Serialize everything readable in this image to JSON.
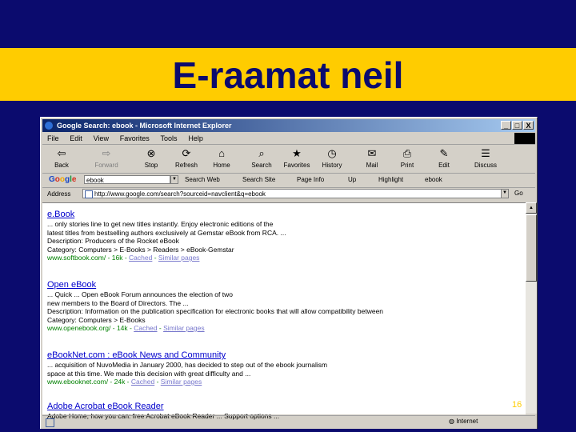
{
  "slide": {
    "title": "E-raamat neil",
    "page_number": "16"
  },
  "window": {
    "title": "Google Search: ebook - Microsoft Internet Explorer",
    "buttons": [
      "_",
      "□",
      "X"
    ]
  },
  "menu": [
    "File",
    "Edit",
    "View",
    "Favorites",
    "Tools",
    "Help"
  ],
  "toolbar": [
    {
      "label": "Back",
      "icon": "back-arrow-icon",
      "glyph": "⇦"
    },
    {
      "label": "Forward",
      "icon": "forward-arrow-icon",
      "glyph": "⇨"
    },
    {
      "label": "Stop",
      "icon": "stop-icon",
      "glyph": "⊗"
    },
    {
      "label": "Refresh",
      "icon": "refresh-icon",
      "glyph": "⟳"
    },
    {
      "label": "Home",
      "icon": "home-icon",
      "glyph": "⌂"
    },
    {
      "label": "Search",
      "icon": "search-icon",
      "glyph": "⌕"
    },
    {
      "label": "Favorites",
      "icon": "favorites-icon",
      "glyph": "★"
    },
    {
      "label": "History",
      "icon": "history-icon",
      "glyph": "◷"
    },
    {
      "label": "Mail",
      "icon": "mail-icon",
      "glyph": "✉"
    },
    {
      "label": "Print",
      "icon": "print-icon",
      "glyph": "⎙"
    },
    {
      "label": "Edit",
      "icon": "edit-icon",
      "glyph": "✎"
    },
    {
      "label": "Discuss",
      "icon": "discuss-icon",
      "glyph": "☰"
    }
  ],
  "google_bar": {
    "query": "ebook",
    "buttons": [
      "Search Web",
      "Search Site",
      "Page Info",
      "Up",
      "Highlight",
      "ebook"
    ]
  },
  "address": {
    "label": "Address",
    "url": "http://www.google.com/search?sourceid=navclient&q=ebook",
    "go_label": "Go"
  },
  "results": [
    {
      "title": "e.Book",
      "lines": [
        "... only stories line to get new titles instantly. Enjoy electronic editions of the",
        "latest titles from bestselling authors exclusively at Gemstar eBook from RCA. ...",
        "Description: Producers of the Rocket eBook",
        "Category: Computers > E-Books > Readers > eBook-Gemstar"
      ],
      "url": "www.softbook.com/ - 16k - ",
      "cached": "Cached",
      "sep": " - ",
      "similar": "Similar pages"
    },
    {
      "title": "Open eBook",
      "lines": [
        "... Quick ... Open eBook Forum announces the election of two",
        "new members to the Board of Directors. The ...",
        "Description: Information on the publication specification for electronic books that will allow compatibility between",
        "Category: Computers > E-Books"
      ],
      "url": "www.openebook.org/ - 14k - ",
      "cached": "Cached",
      "sep": " - ",
      "similar": "Similar pages"
    },
    {
      "title": "eBookNet.com : eBook News and Community",
      "lines": [
        "... acquisition of NuvoMedia in January 2000, has decided to step out of the ebook journalism",
        "space at this time. We made this decision with great difficulty and ..."
      ],
      "url": "www.ebooknet.com/ - 24k - ",
      "cached": "Cached",
      "sep": " - ",
      "similar": "Similar pages"
    },
    {
      "title": "Adobe Acrobat eBook Reader",
      "lines": [
        "Adobe Home, how you can: free Acrobat eBook Reader ... Support options ..."
      ],
      "url": "",
      "cached": "",
      "sep": "",
      "similar": ""
    }
  ],
  "status": {
    "zone": "Internet"
  },
  "colors": {
    "background": "#0b0b6e",
    "title_band": "#ffcc00",
    "link": "#0000cc",
    "url_green": "#008000"
  }
}
